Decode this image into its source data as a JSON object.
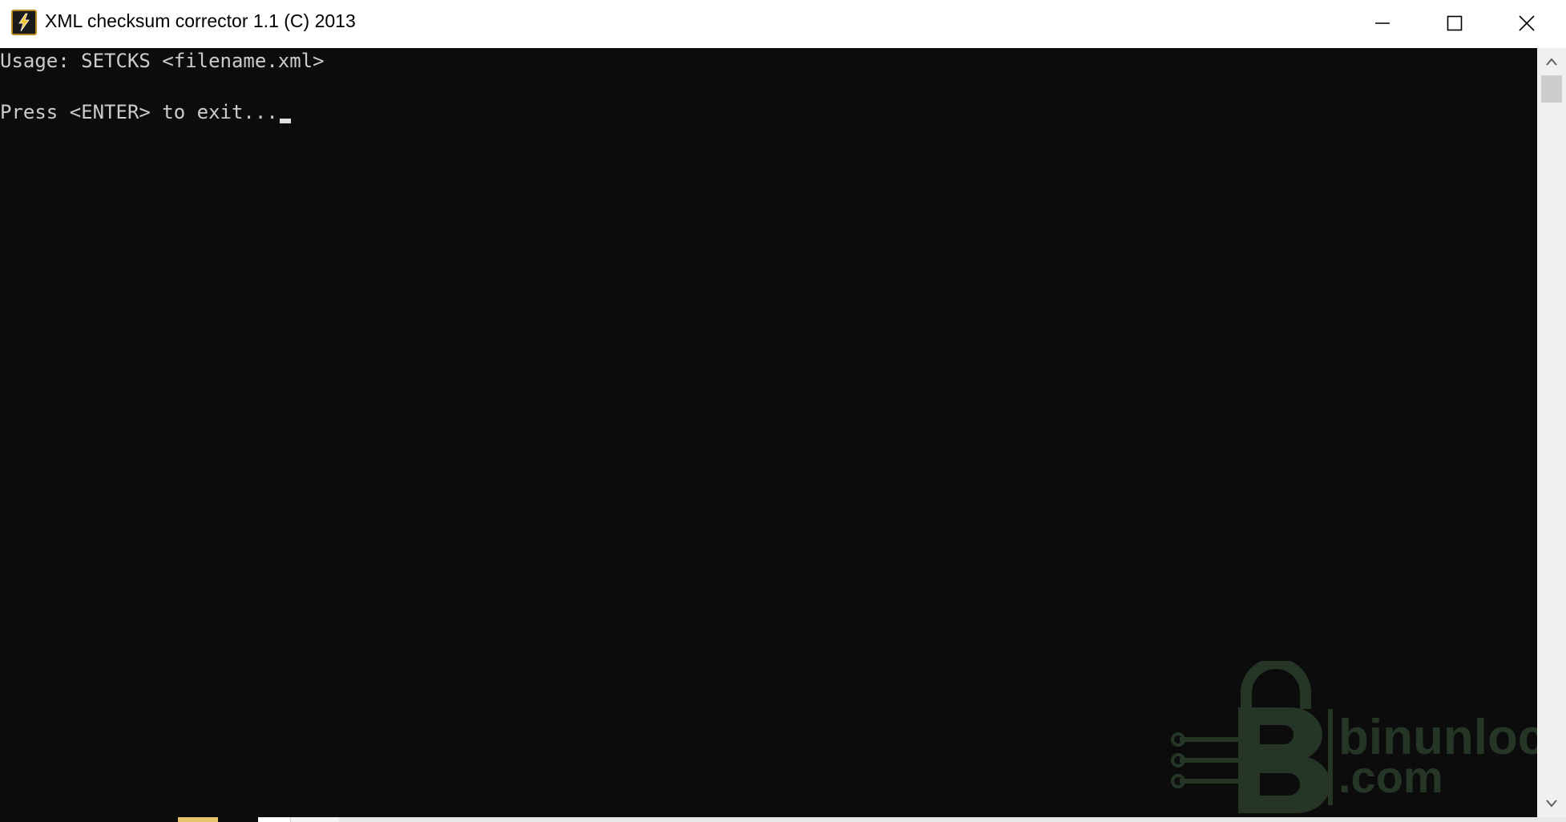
{
  "window": {
    "title": "XML checksum corrector 1.1 (C) 2013",
    "icon": "app-lightning-icon",
    "controls": [
      "minimize-icon",
      "maximize-icon",
      "close-icon"
    ]
  },
  "console": {
    "lines": [
      "Usage: SETCKS <filename.xml>",
      "Press <ENTER> to exit..."
    ],
    "text_color": "#cccccc",
    "background_color": "#0c0c0c"
  },
  "watermark": {
    "line1": "binunlock",
    "line2": ".com",
    "icon": "padlock-circuit-b-logo"
  },
  "scrollbar": {
    "up_icon": "chevron-up-icon",
    "down_icon": "chevron-down-icon"
  }
}
